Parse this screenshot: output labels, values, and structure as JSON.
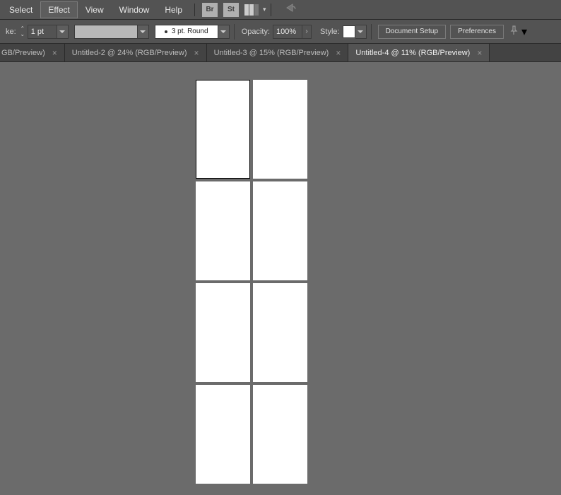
{
  "menubar": {
    "items": [
      {
        "label": "Select"
      },
      {
        "label": "Effect",
        "highlight": true
      },
      {
        "label": "View"
      },
      {
        "label": "Window"
      },
      {
        "label": "Help"
      }
    ],
    "br_label": "Br",
    "st_label": "St"
  },
  "optionsbar": {
    "stroke_label_trunc": "ke:",
    "stroke_value": "1 pt",
    "profile_value": "3 pt. Round",
    "opacity_label": "Opacity:",
    "opacity_value": "100%",
    "style_label": "Style:",
    "doc_setup_label": "Document Setup",
    "prefs_label": "Preferences"
  },
  "tabs": [
    {
      "label": "GB/Preview)",
      "active": false
    },
    {
      "label": "Untitled-2 @ 24% (RGB/Preview)",
      "active": false
    },
    {
      "label": "Untitled-3 @ 15% (RGB/Preview)",
      "active": false
    },
    {
      "label": "Untitled-4 @ 11% (RGB/Preview)",
      "active": true
    }
  ],
  "artboards": {
    "count": 8,
    "selected_index": 0
  }
}
